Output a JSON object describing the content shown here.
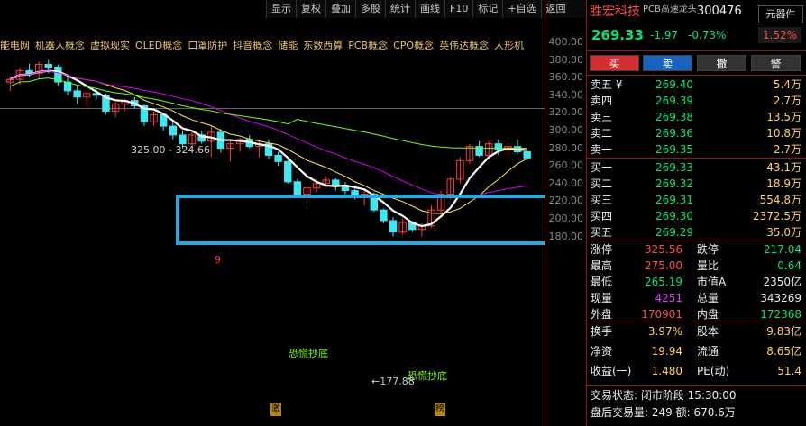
{
  "toolbar": [
    "显示",
    "复权",
    "叠加",
    "多股",
    "统计",
    "画线",
    "F10",
    "标记",
    "+自选",
    "返回"
  ],
  "concepts": [
    "能电网",
    "机器人概念",
    "虚拟现实",
    "OLED概念",
    "口罩防护",
    "抖音概念",
    "储能",
    "东数西算",
    "PCB概念",
    "CPO概念",
    "英伟达概念",
    "人形机"
  ],
  "yaxis": [
    "400.00",
    "380.00",
    "360.00",
    "340.00",
    "320.00",
    "300.00",
    "280.00",
    "260.00",
    "240.00",
    "220.00",
    "200.00",
    "180.00"
  ],
  "annotations": {
    "range_label": "325.00 - 324.66",
    "nine": "9",
    "panic1": "恐慌抄底",
    "panic2": "恐慌抄底",
    "low_label": "←177.88",
    "mark1": "激",
    "mark2": "榜"
  },
  "stock": {
    "name": "胜宏科技",
    "code": "300476",
    "sub": "PCB高速龙头",
    "sector": "元器件",
    "price": "269.33",
    "change": "-1.97",
    "change_pct": "-0.73%",
    "amplitude": "1.52%"
  },
  "buttons": [
    "买",
    "卖",
    "撤",
    "警"
  ],
  "asks": [
    {
      "label": "卖五 ¥",
      "price": "269.40",
      "vol": "5.4万"
    },
    {
      "label": "卖四",
      "price": "269.39",
      "vol": "2.7万"
    },
    {
      "label": "卖三",
      "price": "269.38",
      "vol": "13.5万"
    },
    {
      "label": "卖二",
      "price": "269.36",
      "vol": "10.8万"
    },
    {
      "label": "卖一",
      "price": "269.35",
      "vol": "2.7万"
    }
  ],
  "bids": [
    {
      "label": "买一",
      "price": "269.33",
      "vol": "43.1万"
    },
    {
      "label": "买二",
      "price": "269.32",
      "vol": "18.9万"
    },
    {
      "label": "买三",
      "price": "269.31",
      "vol": "554.8万"
    },
    {
      "label": "买四",
      "price": "269.30",
      "vol": "2372.5万"
    },
    {
      "label": "买五",
      "price": "269.29",
      "vol": "35.0万"
    }
  ],
  "stats1": [
    {
      "l1": "涨停",
      "v1": "325.56",
      "c1": "red",
      "l2": "跌停",
      "v2": "217.04",
      "c2": "green"
    },
    {
      "l1": "最高",
      "v1": "275.00",
      "c1": "red",
      "l2": "量比",
      "v2": "0.64",
      "c2": "green"
    },
    {
      "l1": "最低",
      "v1": "265.19",
      "c1": "green",
      "l2": "市值A",
      "v2": "2350亿",
      "c2": "white"
    },
    {
      "l1": "现量",
      "v1": "4251",
      "c1": "mag",
      "l2": "总量",
      "v2": "343269",
      "c2": "white"
    },
    {
      "l1": "外盘",
      "v1": "170901",
      "c1": "red",
      "l2": "内盘",
      "v2": "172368",
      "c2": "green"
    }
  ],
  "stats2": [
    {
      "l1": "换手",
      "v1": "3.97%",
      "l2": "股本",
      "v2": "9.83亿"
    },
    {
      "l1": "净资",
      "v1": "19.94",
      "l2": "流通",
      "v2": "8.65亿"
    },
    {
      "l1": "收益(一)",
      "v1": "1.480",
      "l2": "PE(动)",
      "v2": "51.4"
    }
  ],
  "footer": {
    "status": "交易状态: 闭市阶段 15:30:00",
    "after": "盘后交易量: 249  额: 670.6万"
  },
  "chart_data": {
    "type": "candlestick",
    "ylim": [
      170,
      410
    ],
    "candles": [
      [
        355,
        360,
        345,
        358
      ],
      [
        358,
        372,
        352,
        368
      ],
      [
        368,
        376,
        360,
        365
      ],
      [
        365,
        378,
        358,
        375
      ],
      [
        375,
        380,
        365,
        372
      ],
      [
        372,
        375,
        350,
        355
      ],
      [
        355,
        362,
        340,
        345
      ],
      [
        345,
        350,
        330,
        338
      ],
      [
        338,
        345,
        328,
        342
      ],
      [
        342,
        348,
        335,
        340
      ],
      [
        340,
        342,
        318,
        322
      ],
      [
        322,
        332,
        315,
        330
      ],
      [
        330,
        336,
        322,
        334
      ],
      [
        334,
        338,
        325,
        328
      ],
      [
        328,
        330,
        305,
        310
      ],
      [
        310,
        322,
        305,
        318
      ],
      [
        318,
        320,
        300,
        305
      ],
      [
        305,
        312,
        290,
        295
      ],
      [
        295,
        300,
        280,
        285
      ],
      [
        285,
        298,
        278,
        295
      ],
      [
        295,
        300,
        285,
        288
      ],
      [
        288,
        305,
        270,
        298
      ],
      [
        298,
        302,
        275,
        280
      ],
      [
        280,
        288,
        265,
        285
      ],
      [
        285,
        292,
        276,
        290
      ],
      [
        290,
        295,
        280,
        282
      ],
      [
        282,
        288,
        270,
        285
      ],
      [
        285,
        290,
        268,
        272
      ],
      [
        272,
        276,
        260,
        265
      ],
      [
        265,
        268,
        240,
        242
      ],
      [
        242,
        245,
        225,
        228
      ],
      [
        228,
        238,
        218,
        235
      ],
      [
        235,
        245,
        230,
        240
      ],
      [
        240,
        248,
        235,
        244
      ],
      [
        244,
        246,
        232,
        238
      ],
      [
        238,
        242,
        228,
        232
      ],
      [
        232,
        236,
        222,
        225
      ],
      [
        225,
        232,
        215,
        228
      ],
      [
        228,
        230,
        208,
        210
      ],
      [
        210,
        212,
        195,
        198
      ],
      [
        198,
        202,
        180,
        185
      ],
      [
        185,
        200,
        182,
        196
      ],
      [
        196,
        198,
        185,
        188
      ],
      [
        188,
        195,
        180,
        192
      ],
      [
        192,
        215,
        190,
        210
      ],
      [
        210,
        232,
        205,
        228
      ],
      [
        228,
        248,
        222,
        245
      ],
      [
        245,
        270,
        240,
        266
      ],
      [
        266,
        285,
        262,
        282
      ],
      [
        282,
        288,
        270,
        272
      ],
      [
        272,
        288,
        268,
        285
      ],
      [
        285,
        290,
        272,
        278
      ],
      [
        278,
        286,
        272,
        282
      ],
      [
        282,
        290,
        274,
        276
      ],
      [
        276,
        278,
        265,
        269
      ]
    ]
  }
}
